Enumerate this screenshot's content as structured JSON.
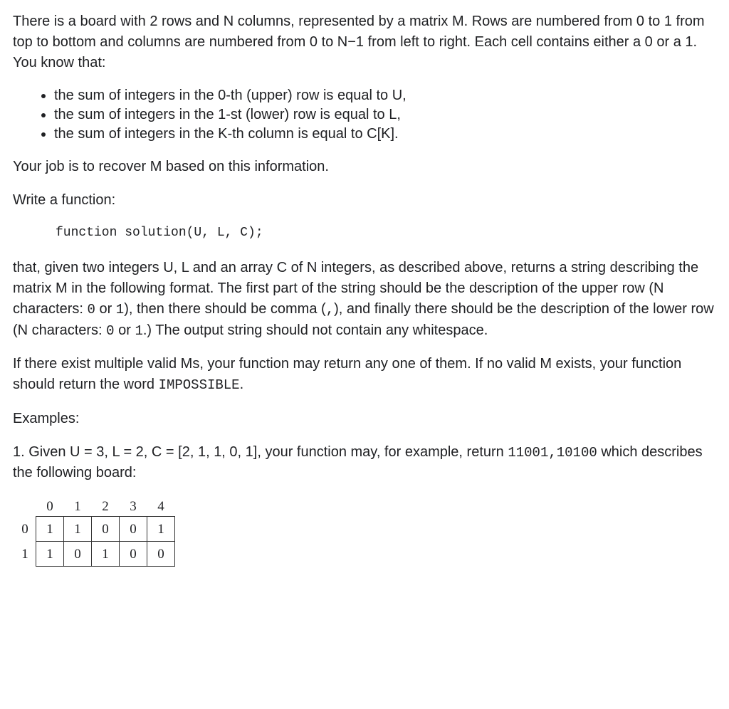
{
  "p1": "There is a board with 2 rows and N columns, represented by a matrix M. Rows are numbered from 0 to 1 from top to bottom and columns are numbered from 0 to N−1 from left to right. Each cell contains either a 0 or a 1. You know that:",
  "bullets": [
    "the sum of integers in the 0-th (upper) row is equal to U,",
    "the sum of integers in the 1-st (lower) row is equal to L,",
    "the sum of integers in the K-th column is equal to C[K]."
  ],
  "p2": "Your job is to recover M based on this information.",
  "p3": "Write a function:",
  "code1": "function solution(U, L, C);",
  "p4a": "that, given two integers U, L and an array C of N integers, as described above, returns a string describing the matrix M in the following format. The first part of the string should be the description of the upper row (N characters: ",
  "p4b": " or ",
  "p4c": "), then there should be comma (",
  "p4d": "), and finally there should be the description of the lower row (N characters: ",
  "p4e": " or ",
  "p4f": ".) The output string should not contain any whitespace.",
  "code_0": "0",
  "code_1": "1",
  "code_comma": ",",
  "p5a": "If there exist multiple valid Ms, your function may return any one of them. If no valid M exists, your function should return the word ",
  "p5b": ".",
  "code_imp": "IMPOSSIBLE",
  "p6": "Examples:",
  "p7a": "1. Given U = 3, L = 2, C = [2, 1, 1, 0, 1], your function may, for example, return ",
  "p7b": " which describes the following board:",
  "code_ex": "11001,10100",
  "board": {
    "col_headers": [
      "0",
      "1",
      "2",
      "3",
      "4"
    ],
    "row_headers": [
      "0",
      "1"
    ],
    "rows": [
      [
        "1",
        "1",
        "0",
        "0",
        "1"
      ],
      [
        "1",
        "0",
        "1",
        "0",
        "0"
      ]
    ]
  }
}
